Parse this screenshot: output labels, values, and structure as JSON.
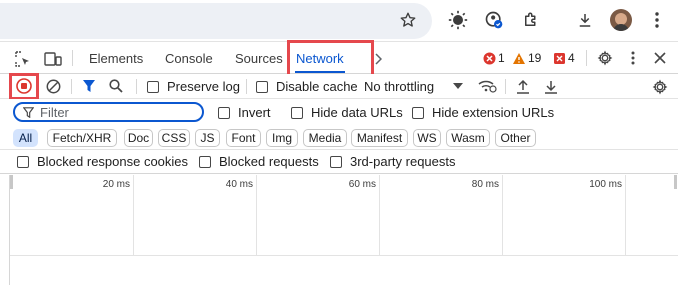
{
  "browser": {
    "icons": [
      "star-icon",
      "chrome-labs-icon",
      "extension-account-icon",
      "puzzle-extensions-icon",
      "download-icon",
      "avatar",
      "more-vert-icon"
    ]
  },
  "devtools": {
    "tabs": [
      {
        "label": "Elements"
      },
      {
        "label": "Console"
      },
      {
        "label": "Sources"
      },
      {
        "label": "Network",
        "active": true
      }
    ],
    "errors": "1",
    "warnings": "19",
    "issues": "4"
  },
  "toolbar": {
    "preserve_log": "Preserve log",
    "disable_cache": "Disable cache",
    "throttling": "No throttling"
  },
  "filter": {
    "placeholder": "Filter",
    "invert": "Invert",
    "hide_data_urls": "Hide data URLs",
    "hide_extension_urls": "Hide extension URLs"
  },
  "types": [
    "All",
    "Fetch/XHR",
    "Doc",
    "CSS",
    "JS",
    "Font",
    "Img",
    "Media",
    "Manifest",
    "WS",
    "Wasm",
    "Other"
  ],
  "more_filters": {
    "blocked_cookies": "Blocked response cookies",
    "blocked_requests": "Blocked requests",
    "third_party": "3rd-party requests"
  },
  "timeline": {
    "ticks": [
      "20 ms",
      "40 ms",
      "60 ms",
      "80 ms",
      "100 ms"
    ]
  },
  "colors": {
    "accent": "#0b57d0",
    "highlight": "#e5484d",
    "error": "#dc362e",
    "warning": "#e37400"
  }
}
